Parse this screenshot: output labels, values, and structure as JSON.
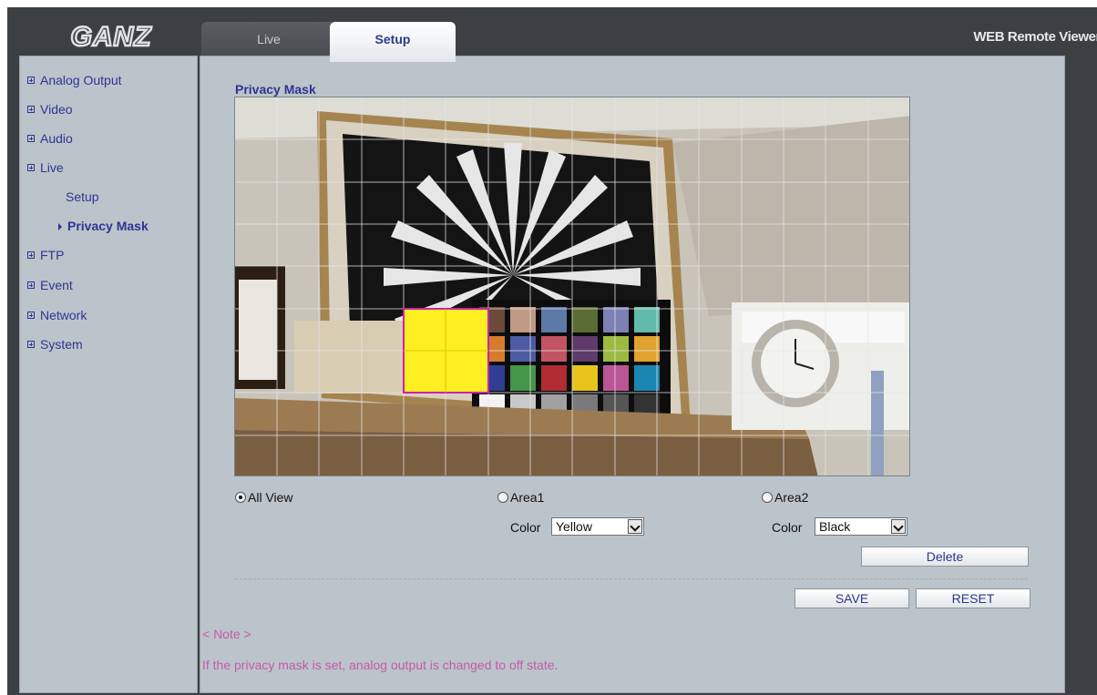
{
  "header": {
    "logo_text": "GANZ",
    "tabs": [
      {
        "label": "Live"
      },
      {
        "label": "Setup"
      }
    ],
    "app_title": "WEB Remote Viewer"
  },
  "sidebar": {
    "items": [
      {
        "label": "Analog Output"
      },
      {
        "label": "Video"
      },
      {
        "label": "Audio"
      },
      {
        "label": "Live"
      },
      {
        "label": "FTP"
      },
      {
        "label": "Event"
      },
      {
        "label": "Network"
      },
      {
        "label": "System"
      }
    ],
    "sub_items": [
      {
        "label": "Setup"
      },
      {
        "label": "Privacy Mask"
      }
    ]
  },
  "main": {
    "title": "Privacy Mask",
    "mask_color": "#ffee22",
    "mask_border": "#cc22aa",
    "options": {
      "all_view": "All View",
      "area1": "Area1",
      "area2": "Area2",
      "color_label": "Color",
      "area1_color": "Yellow",
      "area2_color": "Black"
    },
    "buttons": {
      "delete": "Delete",
      "save": "SAVE",
      "reset": "RESET"
    },
    "note_title": "< Note >",
    "note_text": "If the privacy mask is set, analog output is changed to off state."
  }
}
